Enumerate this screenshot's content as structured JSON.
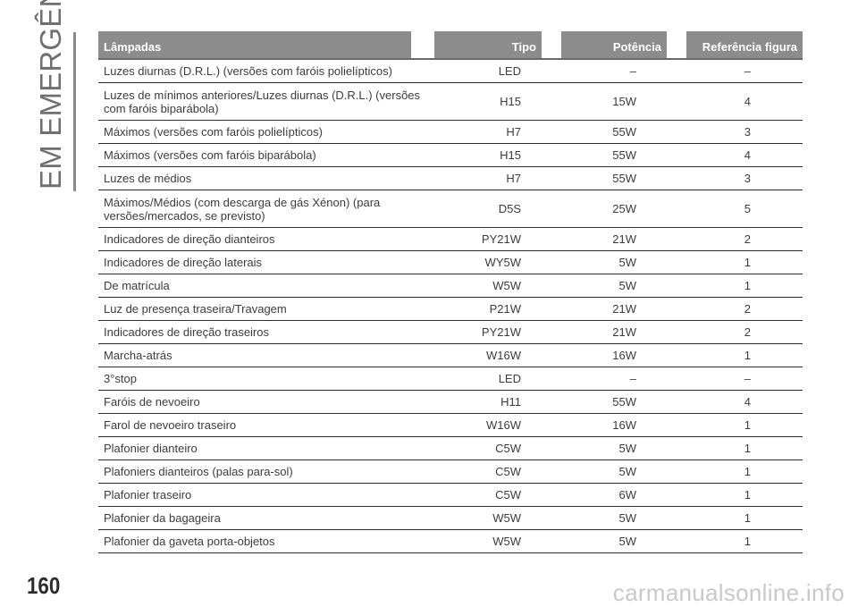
{
  "side_title": "EM EMERGÊNCIA",
  "page_number": "160",
  "watermark": "carmanualsonline.info",
  "table": {
    "headers": [
      "Lâmpadas",
      "Tipo",
      "Potência",
      "Referência figura"
    ],
    "rows": [
      {
        "desc": "Luzes diurnas (D.R.L.) (versões com faróis polielípticos)",
        "type": "LED",
        "power": "–",
        "ref": "–"
      },
      {
        "desc": "Luzes de mínimos anteriores/Luzes diurnas (D.R.L.) (versões com faróis biparábola)",
        "type": "H15",
        "power": "15W",
        "ref": "4"
      },
      {
        "desc": "Máximos (versões com faróis polielípticos)",
        "type": "H7",
        "power": "55W",
        "ref": "3"
      },
      {
        "desc": "Máximos (versões com faróis biparábola)",
        "type": "H15",
        "power": "55W",
        "ref": "4"
      },
      {
        "desc": "Luzes de médios",
        "type": "H7",
        "power": "55W",
        "ref": "3"
      },
      {
        "desc": "Máximos/Médios (com descarga de gás Xénon) (para versões/mercados, se previsto)",
        "type": "D5S",
        "power": "25W",
        "ref": "5"
      },
      {
        "desc": "Indicadores de direção dianteiros",
        "type": "PY21W",
        "power": "21W",
        "ref": "2"
      },
      {
        "desc": "Indicadores de direção laterais",
        "type": "WY5W",
        "power": "5W",
        "ref": "1"
      },
      {
        "desc": "De matrícula",
        "type": "W5W",
        "power": "5W",
        "ref": "1"
      },
      {
        "desc": "Luz de presença traseira/Travagem",
        "type": "P21W",
        "power": "21W",
        "ref": "2"
      },
      {
        "desc": "Indicadores de direção traseiros",
        "type": "PY21W",
        "power": "21W",
        "ref": "2"
      },
      {
        "desc": "Marcha-atrás",
        "type": "W16W",
        "power": "16W",
        "ref": "1"
      },
      {
        "desc": "3°stop",
        "type": "LED",
        "power": "–",
        "ref": "–"
      },
      {
        "desc": "Faróis de nevoeiro",
        "type": "H11",
        "power": "55W",
        "ref": "4"
      },
      {
        "desc": "Farol de nevoeiro traseiro",
        "type": "W16W",
        "power": "16W",
        "ref": "1"
      },
      {
        "desc": "Plafonier dianteiro",
        "type": "C5W",
        "power": "5W",
        "ref": "1"
      },
      {
        "desc": "Plafoniers dianteiros (palas para-sol)",
        "type": "C5W",
        "power": "5W",
        "ref": "1"
      },
      {
        "desc": "Plafonier traseiro",
        "type": "C5W",
        "power": "6W",
        "ref": "1"
      },
      {
        "desc": "Plafonier da bagageira",
        "type": "W5W",
        "power": "5W",
        "ref": "1"
      },
      {
        "desc": "Plafonier da gaveta porta-objetos",
        "type": "W5W",
        "power": "5W",
        "ref": "1"
      }
    ]
  }
}
